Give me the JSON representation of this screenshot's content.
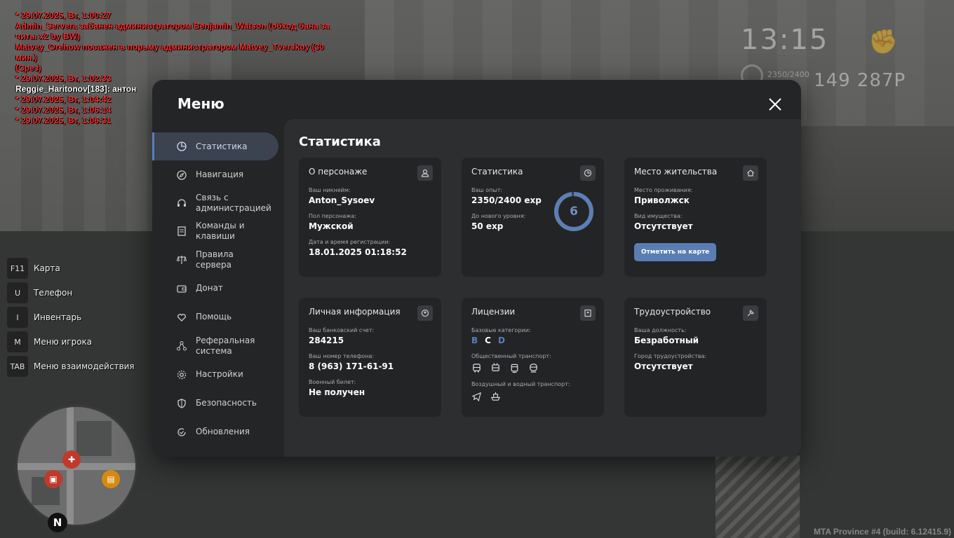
{
  "chat": [
    {
      "text": "* 29.07.2025, Вт, 1:00:27",
      "color": "red"
    },
    {
      "text": "Admin_Servera забанен администратором Benjamin_Watson (обход бана за",
      "color": "red"
    },
    {
      "text": " читы x2 by BW)",
      "color": "red"
    },
    {
      "text": "Matvey_Orehow посажен в порьму администратором Matvey_Tverskoy (30 мин.)",
      "color": "red"
    },
    {
      "text": "(Срез)",
      "color": "red"
    },
    {
      "text": "* 29.07.2025, Вт, 1:02:33",
      "color": "red"
    },
    {
      "text": "Reggie_Haritonov[183]: антон",
      "color": "white"
    },
    {
      "text": "* 29.07.2025, Вт, 1:04:42",
      "color": "red"
    },
    {
      "text": "* 29.07.2025, Вт, 1:06:14",
      "color": "red"
    },
    {
      "text": "* 29.07.2025, Вт, 1:06:31",
      "color": "red"
    }
  ],
  "hud": {
    "time": "13:15",
    "exp": "2350/2400",
    "level": "6",
    "money": "149 287Р"
  },
  "keys": [
    {
      "key": "F11",
      "label": "Карта"
    },
    {
      "key": "U",
      "label": "Телефон"
    },
    {
      "key": "I",
      "label": "Инвентарь"
    },
    {
      "key": "M",
      "label": "Меню игрока"
    },
    {
      "key": "TAB",
      "label": "Меню взаимодействия"
    }
  ],
  "minimap": {
    "compass": "N"
  },
  "build": "MTA Province #4 (build: 6.12415.9)",
  "menu": {
    "title": "Меню",
    "nav": [
      {
        "label": "Статистика",
        "icon": "pie-chart-icon",
        "active": true
      },
      {
        "label": "Навигация",
        "icon": "compass-icon"
      },
      {
        "label": "Связь с администрацией",
        "icon": "headset-icon"
      },
      {
        "label": "Команды и клавиши",
        "icon": "document-icon"
      },
      {
        "label": "Правила сервера",
        "icon": "scales-icon"
      },
      {
        "label": "Донат",
        "icon": "wallet-icon"
      },
      {
        "label": "Помощь",
        "icon": "heart-hand-icon"
      },
      {
        "label": "Реферальная система",
        "icon": "network-icon"
      },
      {
        "label": "Настройки",
        "icon": "gear-icon"
      },
      {
        "label": "Безопасность",
        "icon": "shield-icon"
      },
      {
        "label": "Обновления",
        "icon": "refresh-check-icon"
      }
    ]
  },
  "stats": {
    "title": "Статистика",
    "character": {
      "title": "О персонаже",
      "nickname_label": "Ваш никнейм:",
      "nickname": "Anton_Sysoev",
      "gender_label": "Пол персонажа:",
      "gender": "Мужской",
      "reg_label": "Дата и время регистрации:",
      "reg": "18.01.2025 01:18:52"
    },
    "statistics": {
      "title": "Статистика",
      "exp_label": "Ваш опыт:",
      "exp": "2350/2400 exp",
      "next_label": "До нового уровня:",
      "next": "50 exp",
      "level": "6",
      "level_progress": 0.98,
      "accent": "#5b7fb6"
    },
    "residence": {
      "title": "Место жительства",
      "place_label": "Место проживания:",
      "place": "Приволжск",
      "property_label": "Вид имущества:",
      "property": "Отсутствует",
      "button": "Отметить на карте"
    },
    "personal": {
      "title": "Личная информация",
      "bank_label": "Ваш банковский счет:",
      "bank": "284215",
      "phone_label": "Ваш номер телефона:",
      "phone": "8 (963) 171-61-91",
      "military_label": "Военный билет:",
      "military": "Не получен"
    },
    "licenses": {
      "title": "Лицензии",
      "base_label": "Базовые категории:",
      "categories": [
        {
          "letter": "B",
          "owned": false
        },
        {
          "letter": "C",
          "owned": true
        },
        {
          "letter": "D",
          "owned": false
        }
      ],
      "public_label": "Общественный транспорт:",
      "public_icons": [
        "bus-icon",
        "trolleybus-icon",
        "tram-icon",
        "train-icon"
      ],
      "air_label": "Воздушный и водный транспорт:",
      "air_icons": [
        "plane-icon",
        "boat-icon"
      ]
    },
    "employment": {
      "title": "Трудоустройство",
      "position_label": "Ваша должность:",
      "position": "Безработный",
      "city_label": "Город трудоустройства:",
      "city": "Отсутствует"
    }
  }
}
